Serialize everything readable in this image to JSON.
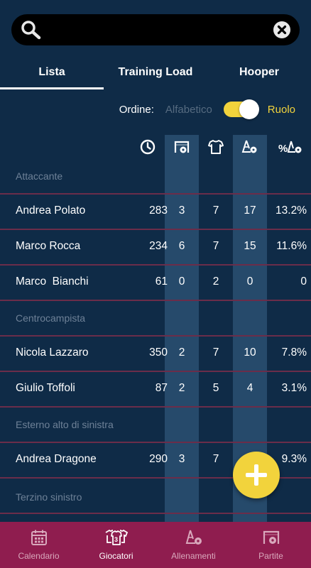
{
  "search": {
    "placeholder": "",
    "value": ""
  },
  "tabs": [
    {
      "label": "Lista",
      "active": true
    },
    {
      "label": "Training Load",
      "active": false
    },
    {
      "label": "Hooper",
      "active": false
    }
  ],
  "order": {
    "label": "Ordine:",
    "option_off": "Alfabetico",
    "option_on": "Ruolo",
    "selected": "Ruolo"
  },
  "columns": [
    {
      "icon": "clock-icon"
    },
    {
      "icon": "goal-ball-icon"
    },
    {
      "icon": "jersey-icon"
    },
    {
      "icon": "cone-ball-icon"
    },
    {
      "icon": "percent-cone-ball-icon"
    }
  ],
  "sections": [
    {
      "title": "Attaccante",
      "players": [
        {
          "name": "Andrea Polato",
          "values": [
            "283",
            "3",
            "7",
            "17",
            "13.2%"
          ]
        },
        {
          "name": "Marco Rocca",
          "values": [
            "234",
            "6",
            "7",
            "15",
            "11.6%"
          ]
        },
        {
          "name": "Marco  Bianchi",
          "values": [
            "61",
            "0",
            "2",
            "0",
            "0"
          ]
        }
      ]
    },
    {
      "title": "Centrocampista",
      "players": [
        {
          "name": "Nicola Lazzaro",
          "values": [
            "350",
            "2",
            "7",
            "10",
            "7.8%"
          ]
        },
        {
          "name": "Giulio Toffoli",
          "values": [
            "87",
            "2",
            "5",
            "4",
            "3.1%"
          ]
        }
      ]
    },
    {
      "title": "Esterno alto di sinistra",
      "players": [
        {
          "name": "Andrea Dragone",
          "values": [
            "290",
            "3",
            "7",
            "",
            "9.3%"
          ]
        }
      ]
    },
    {
      "title": "Terzino sinistro",
      "players": []
    }
  ],
  "bottom_nav": [
    {
      "label": "Calendario",
      "icon": "calendar-icon",
      "active": false
    },
    {
      "label": "Giocatori",
      "icon": "players-icon",
      "active": true
    },
    {
      "label": "Allenamenti",
      "icon": "training-icon",
      "active": false
    },
    {
      "label": "Partite",
      "icon": "match-icon",
      "active": false
    }
  ],
  "colors": {
    "background": "#0f2b47",
    "accent": "#f2d33c",
    "bottom_bar": "#8f1d4f",
    "divider": "#6b2d4a",
    "column_band": "#264a6b"
  }
}
